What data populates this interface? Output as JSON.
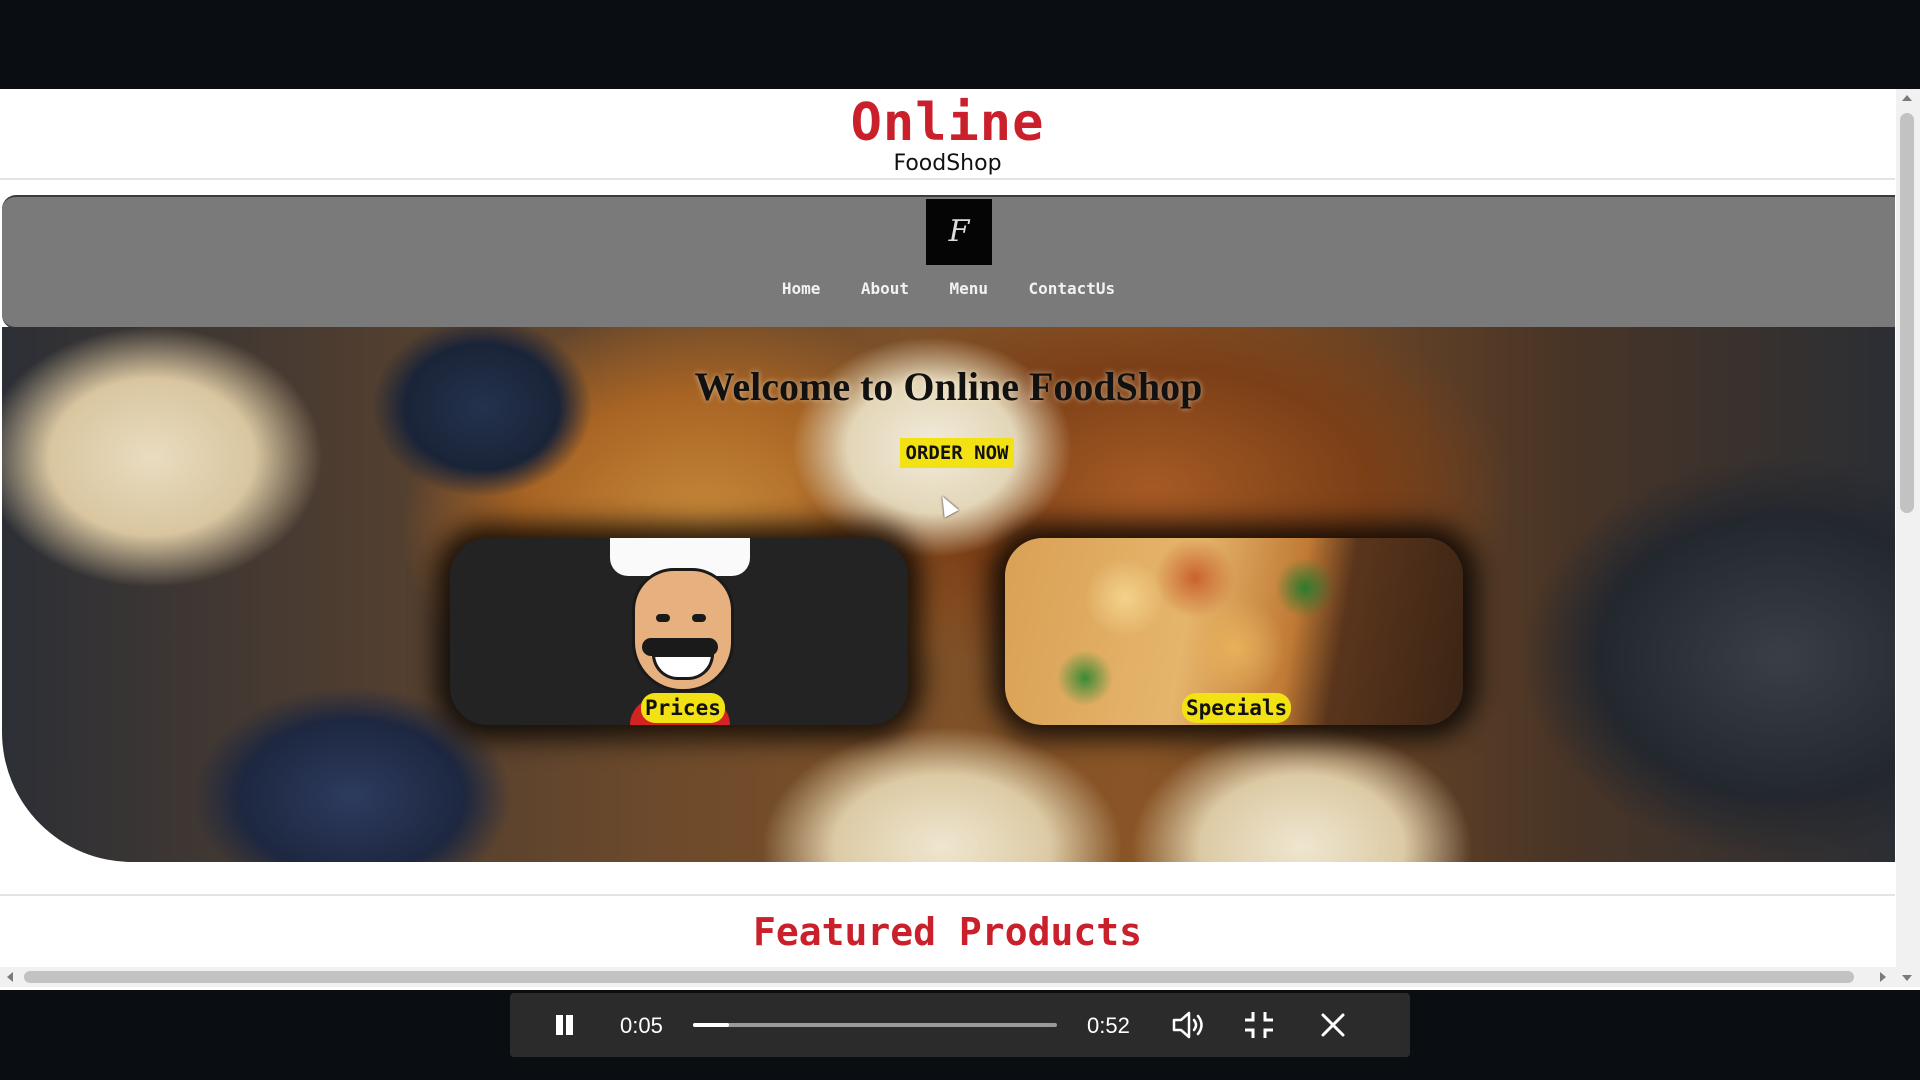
{
  "site": {
    "brand_title": "Online",
    "brand_subtitle": "FoodShop",
    "logo_letter": "F",
    "nav": [
      {
        "label": "Home"
      },
      {
        "label": "About"
      },
      {
        "label": "Menu"
      },
      {
        "label": "ContactUs"
      }
    ],
    "hero": {
      "title": "Welcome to Online FoodShop",
      "cta_label": "ORDER NOW"
    },
    "cards": [
      {
        "label": "Prices"
      },
      {
        "label": "Specials"
      }
    ],
    "featured_title": "Featured Products"
  },
  "player": {
    "current_time": "0:05",
    "total_time": "0:52",
    "progress": 0.1
  },
  "colors": {
    "brand_red": "#c9202b",
    "nav_gray": "#7a7a7a",
    "cta_yellow": "#f2e214",
    "player_bg": "#2b2b2b"
  },
  "icons": {
    "play_state": "pause-icon",
    "volume": "volume-icon",
    "exit_fullscreen": "exit-fullscreen-icon",
    "close": "close-icon"
  }
}
